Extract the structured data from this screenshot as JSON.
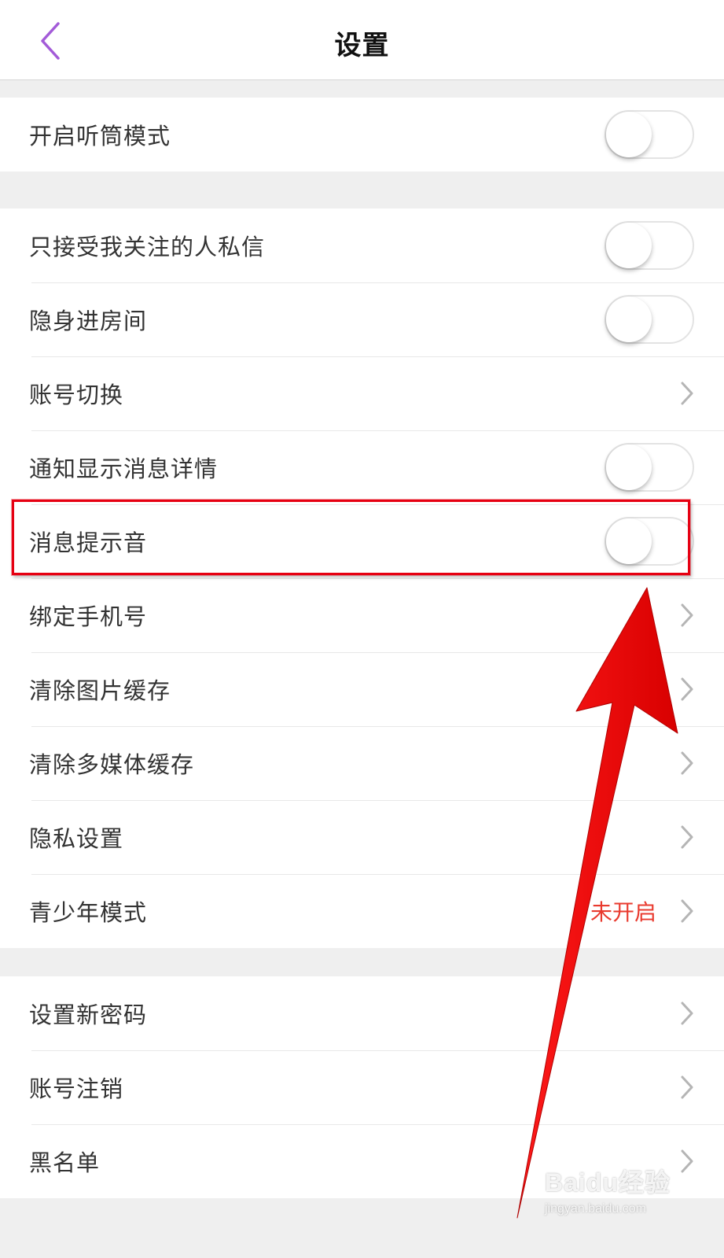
{
  "header": {
    "title": "设置"
  },
  "groups": [
    {
      "rows": [
        {
          "label": "开启听筒模式",
          "control": "toggle",
          "on": false
        }
      ]
    },
    {
      "rows": [
        {
          "label": "只接受我关注的人私信",
          "control": "toggle",
          "on": false
        },
        {
          "label": "隐身进房间",
          "control": "toggle",
          "on": false
        },
        {
          "label": "账号切换",
          "control": "chevron"
        },
        {
          "label": "通知显示消息详情",
          "control": "toggle",
          "on": false
        },
        {
          "label": "消息提示音",
          "control": "toggle",
          "on": false
        },
        {
          "label": "绑定手机号",
          "control": "chevron"
        },
        {
          "label": "清除图片缓存",
          "control": "chevron"
        },
        {
          "label": "清除多媒体缓存",
          "control": "chevron"
        },
        {
          "label": "隐私设置",
          "control": "chevron"
        },
        {
          "label": "青少年模式",
          "control": "chevron",
          "status": "未开启"
        }
      ]
    },
    {
      "rows": [
        {
          "label": "设置新密码",
          "control": "chevron"
        },
        {
          "label": "账号注销",
          "control": "chevron"
        },
        {
          "label": "黑名单",
          "control": "chevron"
        }
      ]
    }
  ],
  "watermark": {
    "logo": "Baidu经验",
    "url": "jingyan.baidu.com"
  },
  "colors": {
    "accent": "#a35bd8",
    "status_red": "#e93a2e",
    "annotation_red": "#e60012"
  }
}
